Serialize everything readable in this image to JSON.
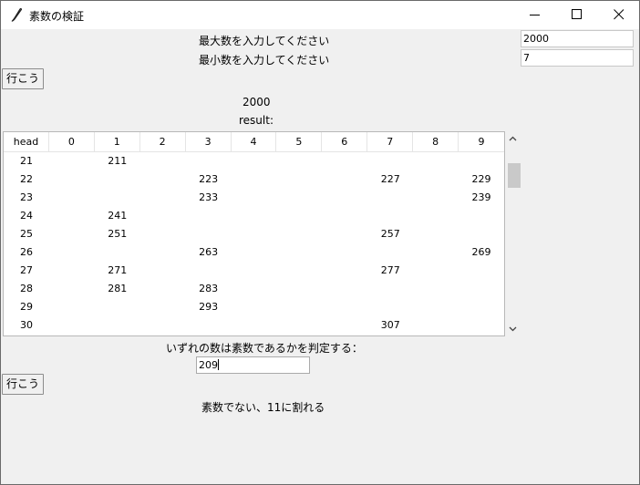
{
  "window": {
    "title": "素数の検証"
  },
  "inputs": {
    "max_label": "最大数を入力してください",
    "max_value": "2000",
    "min_label": "最小数を入力してください",
    "min_value": "7"
  },
  "buttons": {
    "go_label_1": "行こう",
    "go_label_2": "行こう"
  },
  "result": {
    "count_text": "2000",
    "result_label": "result:"
  },
  "table": {
    "headers": [
      "head",
      "0",
      "1",
      "2",
      "3",
      "4",
      "5",
      "6",
      "7",
      "8",
      "9"
    ],
    "rows": [
      [
        "21",
        "",
        "211",
        "",
        "",
        "",
        "",
        "",
        "",
        "",
        ""
      ],
      [
        "22",
        "",
        "",
        "",
        "223",
        "",
        "",
        "",
        "227",
        "",
        "229"
      ],
      [
        "23",
        "",
        "",
        "",
        "233",
        "",
        "",
        "",
        "",
        "",
        "239"
      ],
      [
        "24",
        "",
        "241",
        "",
        "",
        "",
        "",
        "",
        "",
        "",
        ""
      ],
      [
        "25",
        "",
        "251",
        "",
        "",
        "",
        "",
        "",
        "257",
        "",
        ""
      ],
      [
        "26",
        "",
        "",
        "",
        "263",
        "",
        "",
        "",
        "",
        "",
        "269"
      ],
      [
        "27",
        "",
        "271",
        "",
        "",
        "",
        "",
        "",
        "277",
        "",
        ""
      ],
      [
        "28",
        "",
        "281",
        "",
        "283",
        "",
        "",
        "",
        "",
        "",
        ""
      ],
      [
        "29",
        "",
        "",
        "",
        "293",
        "",
        "",
        "",
        "",
        "",
        ""
      ],
      [
        "30",
        "",
        "",
        "",
        "",
        "",
        "",
        "",
        "307",
        "",
        ""
      ]
    ]
  },
  "check": {
    "prompt": "いずれの数は素数であるかを判定する：",
    "value": "209",
    "message": "素数でない、11に割れる"
  },
  "icons": {
    "app": "feather-icon",
    "minimize": "minimize-icon",
    "maximize": "maximize-icon",
    "close": "close-icon"
  }
}
